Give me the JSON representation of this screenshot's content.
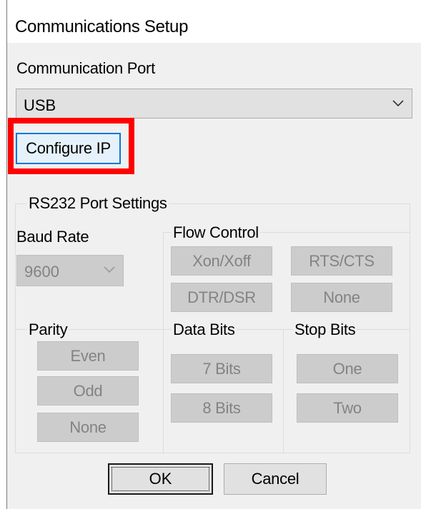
{
  "window": {
    "title": "Communications Setup"
  },
  "port": {
    "label": "Communication Port",
    "selected": "USB"
  },
  "configure_ip": {
    "label": "Configure IP"
  },
  "rs232": {
    "title": "RS232 Port Settings",
    "baud": {
      "label": "Baud Rate",
      "selected": "9600"
    },
    "flow": {
      "title": "Flow Control",
      "xon": "Xon/Xoff",
      "rts": "RTS/CTS",
      "dtr": "DTR/DSR",
      "none": "None"
    },
    "parity": {
      "title": "Parity",
      "even": "Even",
      "odd": "Odd",
      "none": "None"
    },
    "data_bits": {
      "title": "Data Bits",
      "seven": "7 Bits",
      "eight": "8 Bits"
    },
    "stop_bits": {
      "title": "Stop Bits",
      "one": "One",
      "two": "Two"
    }
  },
  "actions": {
    "ok": "OK",
    "cancel": "Cancel"
  },
  "colors": {
    "highlight": "#ff0000",
    "focus": "#0078d7",
    "dialog_bg": "#f0f0f0"
  },
  "icons": {
    "dropdown": "chevron-down-icon"
  }
}
